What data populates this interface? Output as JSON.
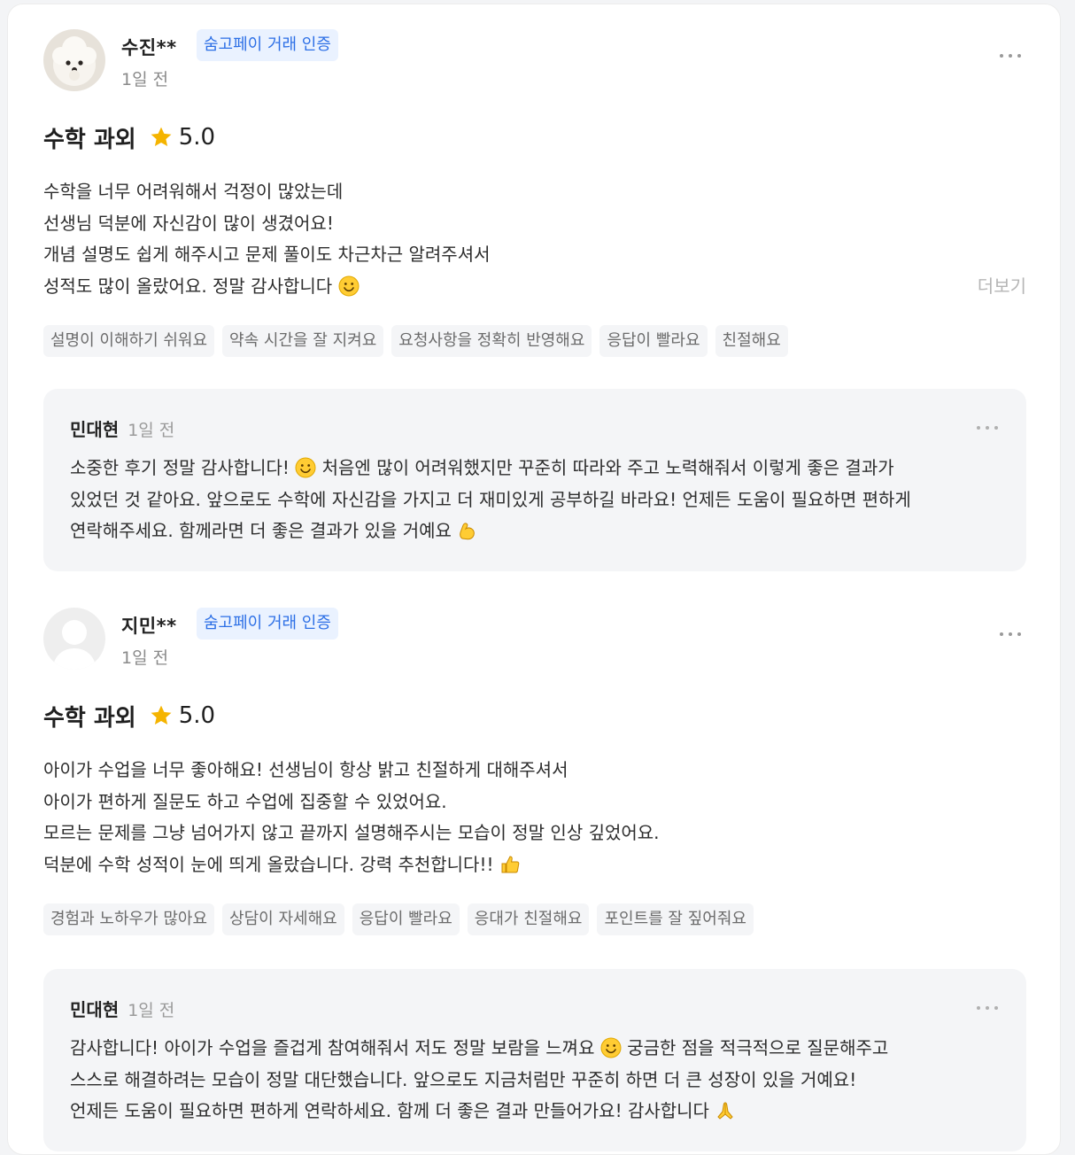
{
  "reviews": [
    {
      "user_name": "수진**",
      "badge": "숨고페이 거래 인증",
      "time": "1일 전",
      "title": "수학 과외",
      "score": "5.0",
      "lines": [
        "수학을 너무 어려워해서 걱정이 많았는데",
        "선생님 덕분에 자신감이 많이 생겼어요!",
        "개념 설명도 쉽게 해주시고 문제 풀이도 차근차근 알려주셔서",
        "성적도 많이 올랐어요. 정말 감사합니다"
      ],
      "see_more": "더보기",
      "tags": [
        "설명이 이해하기 쉬워요",
        "약속 시간을 잘 지켜요",
        "요청사항을 정확히 반영해요",
        "응답이 빨라요",
        "친절해요"
      ],
      "reply": {
        "author": "민대현",
        "time": "1일 전",
        "lines": [
          "소중한 후기 정말 감사합니다!",
          "처음엔 많이 어려워했지만 꾸준히 따라와 주고 노력해줘서 이렇게 좋은 결과가",
          "있었던 것 같아요. 앞으로도 수학에 자신감을 가지고 더 재미있게 공부하길 바라요! 언제든 도움이 필요하면 편하게",
          "연락해주세요. 함께라면 더 좋은 결과가 있을 거예요"
        ]
      }
    },
    {
      "user_name": "지민**",
      "badge": "숨고페이 거래 인증",
      "time": "1일 전",
      "title": "수학 과외",
      "score": "5.0",
      "lines": [
        "아이가 수업을 너무 좋아해요! 선생님이 항상 밝고 친절하게 대해주셔서",
        "아이가 편하게 질문도 하고 수업에 집중할 수 있었어요.",
        "모르는 문제를 그냥 넘어가지 않고 끝까지 설명해주시는 모습이 정말 인상 깊었어요.",
        "덕분에 수학 성적이 눈에 띄게 올랐습니다. 강력 추천합니다!!"
      ],
      "tags": [
        "경험과 노하우가 많아요",
        "상담이 자세해요",
        "응답이 빨라요",
        "응대가 친절해요",
        "포인트를 잘 짚어줘요"
      ],
      "reply": {
        "author": "민대현",
        "time": "1일 전",
        "lines": [
          "감사합니다! 아이가 수업을 즐겁게 참여해줘서 저도 정말 보람을 느껴요",
          "궁금한 점을 적극적으로 질문해주고",
          "스스로 해결하려는 모습이 정말 대단했습니다. 앞으로도 지금처럼만 꾸준히 하면 더 큰 성장이 있을 거예요!",
          "언제든 도움이 필요하면 편하게 연락하세요. 함께 더 좋은 결과 만들어가요! 감사합니다"
        ]
      }
    }
  ],
  "icons": {
    "star": "star-icon",
    "smile": "smile-emoji-icon",
    "muscle": "flexed-biceps-icon",
    "thumbs": "thumbs-up-icon",
    "pray": "folded-hands-icon"
  },
  "colors": {
    "badge_text": "#2c6fe6",
    "badge_bg": "#eaf2ff",
    "star": "#f5b400",
    "tag_bg": "#f4f5f7"
  }
}
